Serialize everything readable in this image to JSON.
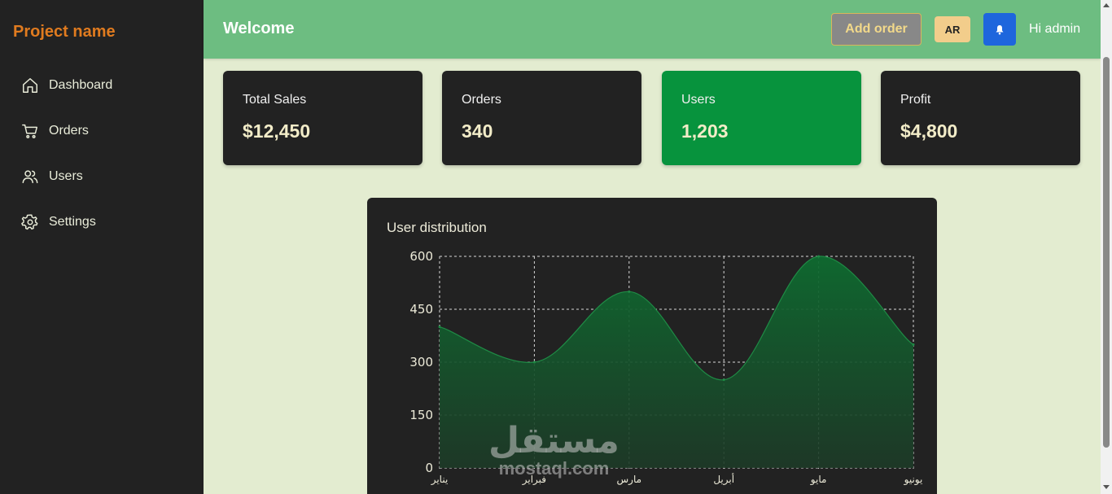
{
  "sidebar": {
    "brand": "Project name",
    "items": [
      {
        "label": "Dashboard",
        "icon": "home-icon"
      },
      {
        "label": "Orders",
        "icon": "cart-icon"
      },
      {
        "label": "Users",
        "icon": "users-icon"
      },
      {
        "label": "Settings",
        "icon": "gear-icon"
      }
    ]
  },
  "header": {
    "title": "Welcome",
    "add_order_label": "Add order",
    "lang_label": "AR",
    "bell_icon": "bell-icon",
    "greeting": "Hi admin"
  },
  "stats": [
    {
      "label": "Total Sales",
      "value": "$12,450"
    },
    {
      "label": "Orders",
      "value": "340"
    },
    {
      "label": "Users",
      "value": "1,203"
    },
    {
      "label": "Profit",
      "value": "$4,800"
    }
  ],
  "chart_data": {
    "type": "area",
    "title": "User distribution",
    "categories": [
      "يناير",
      "فبراير",
      "مارس",
      "أبريل",
      "مايو",
      "يونيو"
    ],
    "values": [
      400,
      300,
      500,
      250,
      600,
      350
    ],
    "ylim": [
      0,
      600
    ],
    "yticks": [
      0,
      150,
      300,
      450,
      600
    ],
    "grid": true,
    "colors": {
      "fill": "#0f5e2c",
      "line": "#1f8a45",
      "grid": "#d8d8d8"
    }
  },
  "watermark": {
    "arabic": "مستقل",
    "latin": "mostaql.com"
  },
  "colors": {
    "sidebar": "#222222",
    "topbar": "#6dbd81",
    "accent_orange": "#e07b1f",
    "highlight_card": "#07933d",
    "bell_button": "#1e66dd",
    "lang_button": "#f2cd8b"
  }
}
